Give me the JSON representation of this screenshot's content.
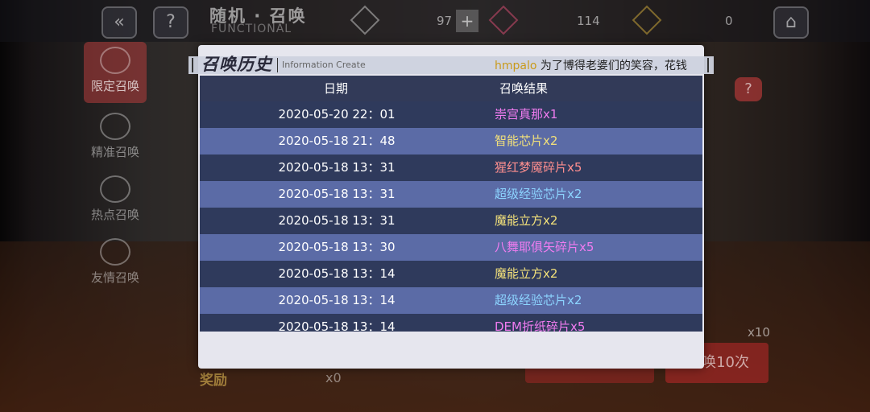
{
  "topbar": {
    "title": "随机 · 召唤",
    "subtitle": "FUNCTIONAL",
    "back_icon": "chevron-left",
    "help_icon": "question",
    "res1_value": "97",
    "plus": "+",
    "res2_value": "114",
    "res3_value": "0"
  },
  "sidebar": {
    "items": [
      {
        "label": "限定召唤"
      },
      {
        "label": "精准召唤"
      },
      {
        "label": "热点召唤"
      },
      {
        "label": "友情召唤"
      }
    ]
  },
  "background": {
    "reward_label": "奖励",
    "reward_count": "x0",
    "right_count": "x10",
    "summon10_label": "唤10次",
    "help_right": "?"
  },
  "dialog": {
    "title": "召唤历史",
    "subtitle": "Information Create",
    "news_user": "hmpalo",
    "news_text": "为了博得老婆们的笑容，花钱",
    "col_date": "日期",
    "col_result": "召唤结果",
    "rows": [
      {
        "date": "2020-05-20 22：01",
        "result": "崇宫真那x1",
        "color": "pink"
      },
      {
        "date": "2020-05-18 21：48",
        "result": "智能芯片x2",
        "color": "yellow"
      },
      {
        "date": "2020-05-18 13：31",
        "result": "猩红梦魇碎片x5",
        "color": "red"
      },
      {
        "date": "2020-05-18 13：31",
        "result": "超级经验芯片x2",
        "color": "blue"
      },
      {
        "date": "2020-05-18 13：31",
        "result": "魔能立方x2",
        "color": "yellow"
      },
      {
        "date": "2020-05-18 13：30",
        "result": "八舞耶俱矢碎片x5",
        "color": "pink"
      },
      {
        "date": "2020-05-18 13：14",
        "result": "魔能立方x2",
        "color": "yellow"
      },
      {
        "date": "2020-05-18 13：14",
        "result": "超级经验芯片x2",
        "color": "blue"
      },
      {
        "date": "2020-05-18 13：14",
        "result": "DEM折纸碎片x5",
        "color": "pink"
      }
    ]
  }
}
